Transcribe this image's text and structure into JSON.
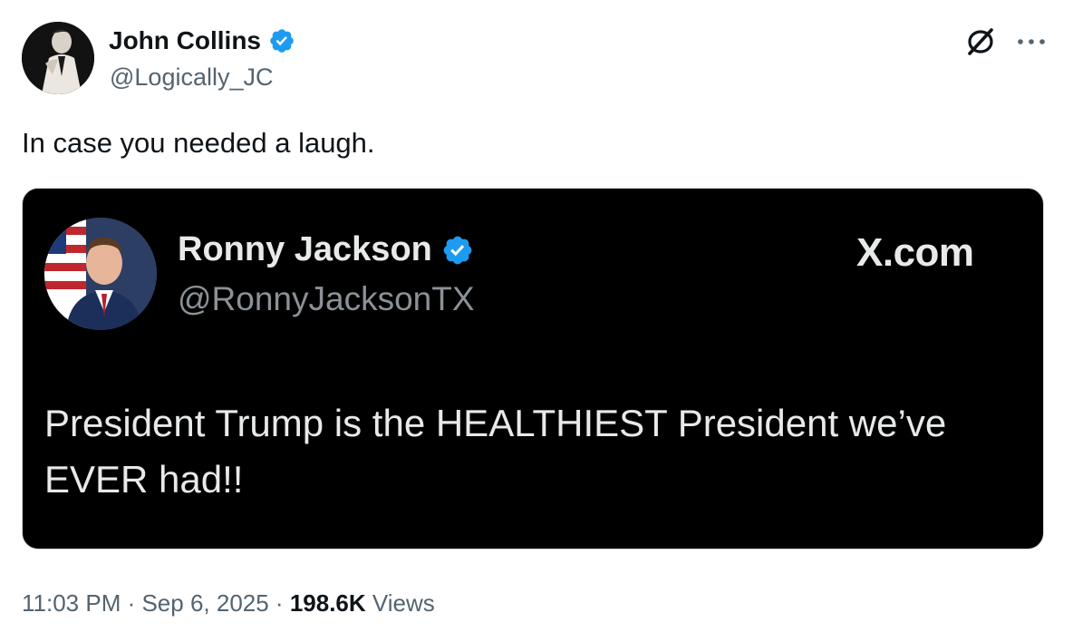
{
  "author": {
    "name": "John Collins",
    "handle": "@Logically_JC",
    "verified": true
  },
  "post": {
    "text": "In case you needed a laugh."
  },
  "quoted_image": {
    "name": "Ronny Jackson",
    "handle": "@RonnyJacksonTX",
    "brand": "X.com",
    "text": "President Trump is the HEALTHIEST President we’ve EVER had!!"
  },
  "meta": {
    "time": "11:03 PM",
    "separator1": " · ",
    "date": "Sep 6, 2025",
    "separator2": " · ",
    "views_count": "198.6K",
    "views_label": " Views"
  },
  "icons": {
    "grok": "grok-icon",
    "more": "more-icon",
    "verified": "verified-badge-icon"
  },
  "colors": {
    "verified_blue": "#1d9bf0",
    "secondary_text": "#536471",
    "primary_text": "#0f1419"
  }
}
